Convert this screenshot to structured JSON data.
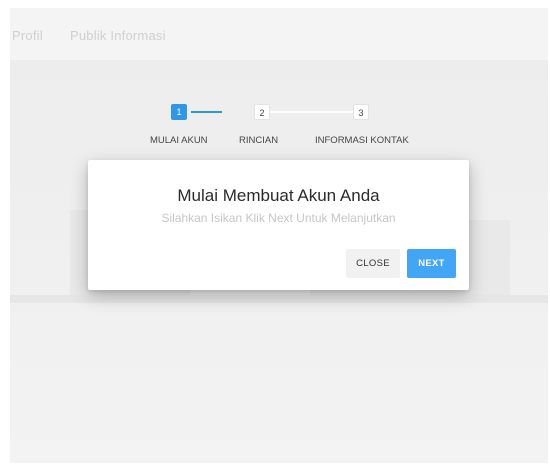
{
  "topbar": {
    "links": [
      "Profil",
      "Publik Informasi"
    ]
  },
  "stepper": {
    "steps": [
      {
        "number": "1",
        "label": "MULAI AKUN",
        "state": "active"
      },
      {
        "number": "2",
        "label": "RINCIAN",
        "state": "idle"
      },
      {
        "number": "3",
        "label": "INFORMASI KONTAK",
        "state": "idle"
      }
    ]
  },
  "modal": {
    "title": "Mulai Membuat Akun Anda",
    "subtitle": "Silahkan Isikan Klik Next Untuk Melanjutkan",
    "close_label": "CLOSE",
    "next_label": "NEXT"
  },
  "colors": {
    "accent": "#2f97e8",
    "next_button": "#42a5f5"
  }
}
